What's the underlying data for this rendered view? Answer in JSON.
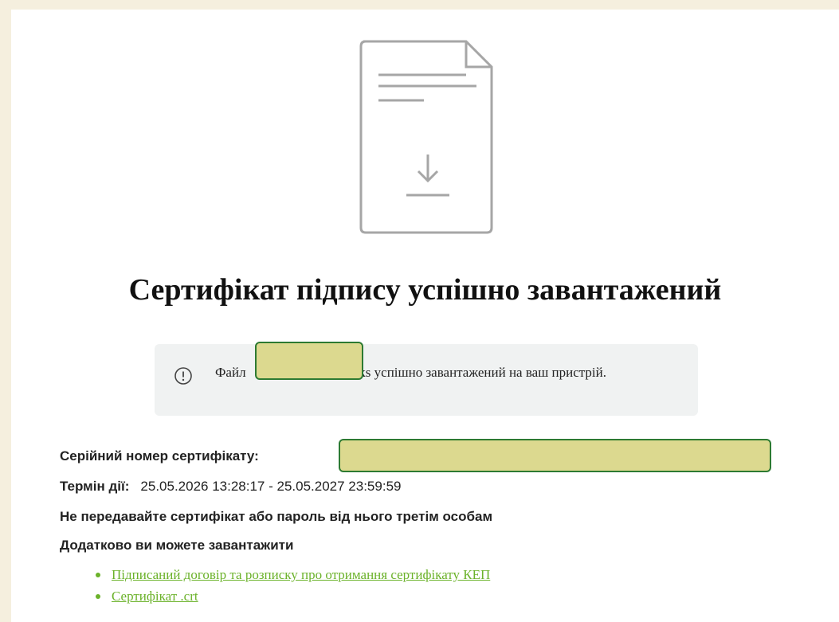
{
  "title": "Сертифікат підпису успішно завантажений",
  "notice": {
    "text_before": "Файл ",
    "text_after": "2.jks успішно завантажений на ваш пристрій."
  },
  "serial": {
    "label": "Серійний номер сертифікату:"
  },
  "validity": {
    "label": "Термін дії:",
    "value": "25.05.2026 13:28:17 - 25.05.2027 23:59:59"
  },
  "warning": "Не передавайте сертифікат або пароль від нього третім особам",
  "extra_heading": "Додатково ви можете завантажити",
  "links": [
    {
      "label": "Підписаний договір та розписку про отримання сертифікату КЕП"
    },
    {
      "label": "Сертифікат .crt"
    }
  ],
  "colors": {
    "link": "#6bb22a",
    "redaction": "#dcd98f",
    "redaction_border": "#2d7a32",
    "background": "#f5efde"
  }
}
